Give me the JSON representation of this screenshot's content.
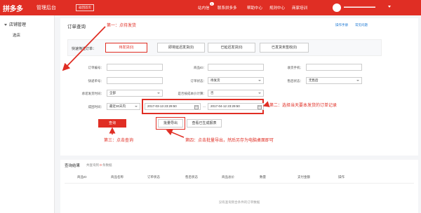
{
  "brand": {
    "logo": "拼多多",
    "subtitle": "管理后台",
    "home_button": "返回首页"
  },
  "topnav": {
    "items": [
      {
        "label": "站内信",
        "badge": "1"
      },
      {
        "label": "联系拼多多"
      },
      {
        "label": "帮助中心"
      },
      {
        "label": "规则中心"
      },
      {
        "label": "商家培训"
      }
    ],
    "user_name": "▬▬▬▬▬▬▬▬▬"
  },
  "sidebar": {
    "group": "店铺管理",
    "items": [
      "选店"
    ]
  },
  "page": {
    "title": "订单查询",
    "links": [
      "操作手册",
      "常见问题"
    ]
  },
  "quick_filter": {
    "label": "快速筛选订单：",
    "tabs": [
      "待发货(0)",
      "即将延迟发货(0)",
      "已延迟发货(0)",
      "已发货未签收(0)"
    ]
  },
  "form": {
    "order_no": {
      "label": "订单编号：",
      "value": ""
    },
    "product_id": {
      "label": "商品ID：",
      "value": ""
    },
    "recipient_phone": {
      "label": "收货手机：",
      "value": ""
    },
    "tracking_no": {
      "label": "快递单号：",
      "value": ""
    },
    "recipient_name": {
      "label": "收货人：",
      "value": ""
    },
    "order_status": {
      "label": "订单状态：",
      "value": "待发货"
    },
    "aftersale_status": {
      "label": "售后状态：",
      "value": "无售后"
    },
    "ship_method": {
      "label": "承诺发货时间：",
      "value": "全部"
    },
    "invoice": {
      "label": "是否按成本价计算：",
      "value": "否"
    },
    "created_time": {
      "label": "成团时间：",
      "range": "最近30天内",
      "start": "2017-03-13 23:29:50",
      "end": "2017-04-12 23:29:50"
    }
  },
  "buttons": {
    "search": "查询",
    "batch_export": "批量导出",
    "view_exports": "查看已生成报表"
  },
  "results": {
    "title": "查询结果",
    "count_prefix": "共查询到",
    "count": "0",
    "count_suffix": "条数据",
    "columns": [
      "商品ID",
      "商品名称",
      "订单状态",
      "售后状态",
      "商品总价",
      "数量",
      "支付金额",
      "操作"
    ],
    "empty_text": "没有查询到合条件的订单数据"
  },
  "annotations": {
    "step1": "第一：点待发货",
    "step2": "第二：选择当天要本发货的订单记录",
    "step3": "第三：点击查询",
    "step4": "第四：点击批量导出，然后另存为电脑桌面即可"
  },
  "colors": {
    "brand_red": "#e02e24",
    "annotation_red": "#e02e24",
    "link_blue": "#1976d2"
  }
}
